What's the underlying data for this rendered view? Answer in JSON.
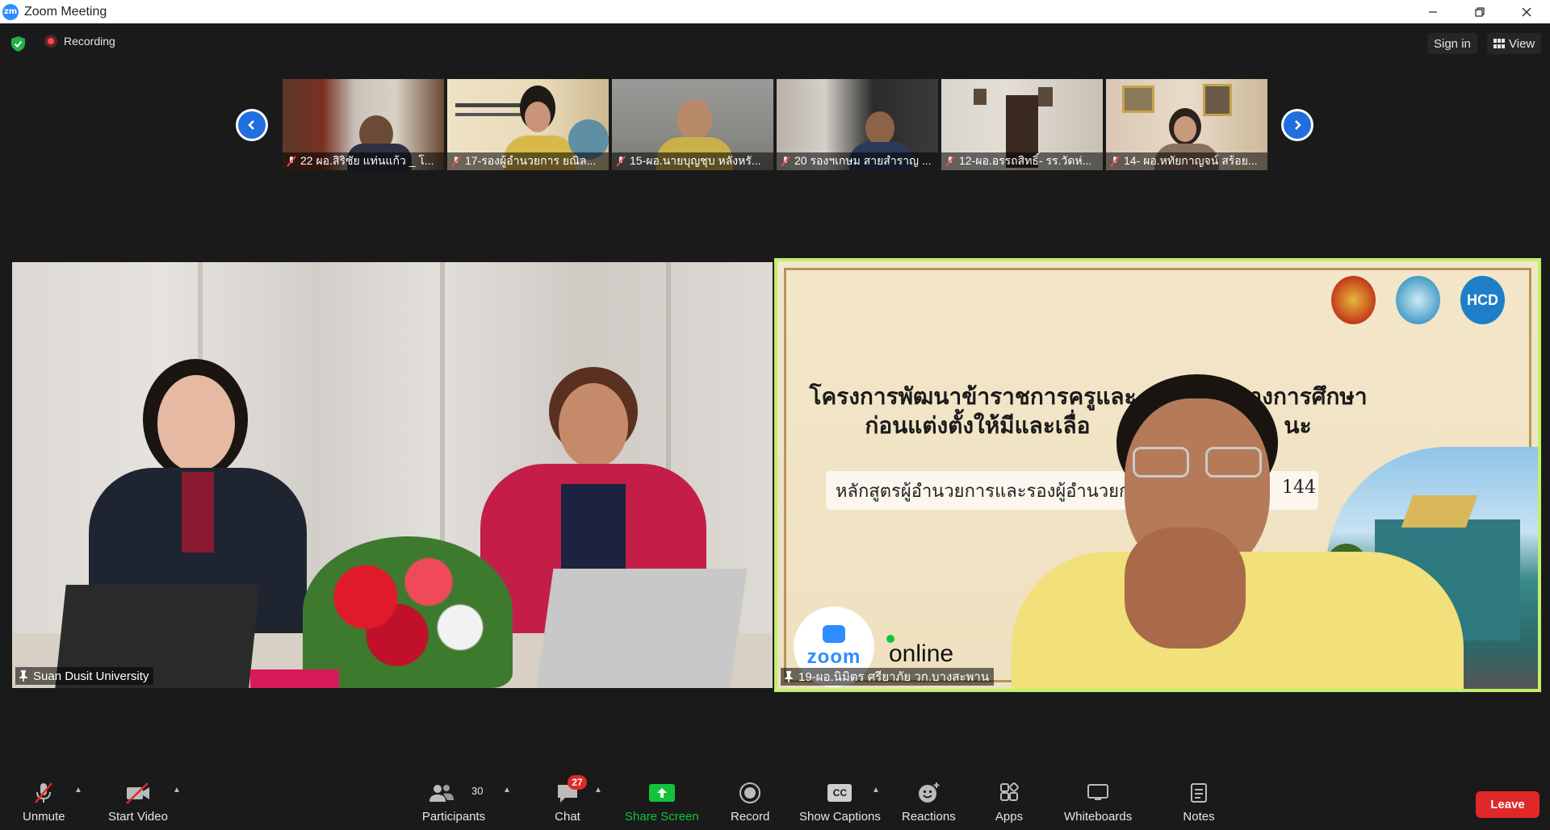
{
  "window": {
    "title": "Zoom Meeting",
    "logo_text": "zm"
  },
  "topbar": {
    "recording_label": "Recording",
    "sign_in": "Sign in",
    "view": "View"
  },
  "thumbnails": [
    {
      "name": "22 ผอ.สิริชัย แท่นแก้ว _ โ..."
    },
    {
      "name": "17-รองผู้อำนวยการ ยณิล..."
    },
    {
      "name": "15-ผอ.นายบุญชุบ หลังหรั..."
    },
    {
      "name": "20 รองฯเกษม สายสำราญ ..."
    },
    {
      "name": "12-ผอ.อรรถสิทธิ์- รร.วัดห่..."
    },
    {
      "name": "14- ผอ.หทัยกาญจน์ สร้อย..."
    }
  ],
  "main_videos": {
    "left": {
      "name": "Suan Dusit University"
    },
    "right": {
      "name": "19-ผอ.นิมิตร ศรียาภัย  วก.บางสะพาน"
    }
  },
  "slide": {
    "title_line1": "โครงการพัฒนาข้าราชการครูและ",
    "title_line1_tail": "างการศึกษา",
    "title_line2": "ก่อนแต่งตั้งให้มีและเลื่อ",
    "title_line2_tail": "นะ",
    "subtitle": "หลักสูตรผู้อำนวยการและรองผู้อำนวยก",
    "subtitle_number": "144",
    "logo_hcd": "HCD",
    "zoom_text": "zoom",
    "online_text": "online"
  },
  "toolbar": {
    "unmute": "Unmute",
    "start_video": "Start Video",
    "participants": "Participants",
    "participants_count": "30",
    "chat": "Chat",
    "chat_badge": "27",
    "share_screen": "Share Screen",
    "record": "Record",
    "show_captions": "Show Captions",
    "cc": "CC",
    "reactions": "Reactions",
    "apps": "Apps",
    "whiteboards": "Whiteboards",
    "notes": "Notes",
    "leave": "Leave"
  },
  "colors": {
    "active_speaker_border": "#c2f06a",
    "share_green": "#12c43c",
    "leave_red": "#e02828",
    "zoom_blue": "#2d8cff"
  }
}
